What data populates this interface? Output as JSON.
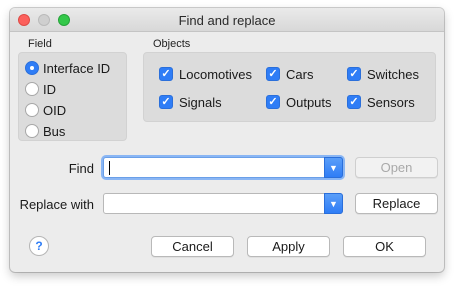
{
  "window": {
    "title": "Find and replace",
    "controls": [
      "close",
      "minimize",
      "zoom"
    ]
  },
  "field": {
    "label": "Field",
    "options": [
      {
        "label": "Interface ID",
        "selected": true
      },
      {
        "label": "ID",
        "selected": false
      },
      {
        "label": "OID",
        "selected": false
      },
      {
        "label": "Bus",
        "selected": false
      }
    ]
  },
  "objects": {
    "label": "Objects",
    "items": [
      {
        "label": "Locomotives",
        "checked": true
      },
      {
        "label": "Cars",
        "checked": true
      },
      {
        "label": "Switches",
        "checked": true
      },
      {
        "label": "Signals",
        "checked": true
      },
      {
        "label": "Outputs",
        "checked": true
      },
      {
        "label": "Sensors",
        "checked": true
      }
    ]
  },
  "find": {
    "label": "Find",
    "value": "",
    "open_label": "Open",
    "open_enabled": false
  },
  "replace": {
    "label": "Replace with",
    "value": "",
    "button_label": "Replace"
  },
  "footer": {
    "help_label": "?",
    "cancel_label": "Cancel",
    "apply_label": "Apply",
    "ok_label": "OK"
  },
  "colors": {
    "accent": "#2f7df6",
    "close": "#fc605c",
    "zoom": "#34c84a"
  }
}
